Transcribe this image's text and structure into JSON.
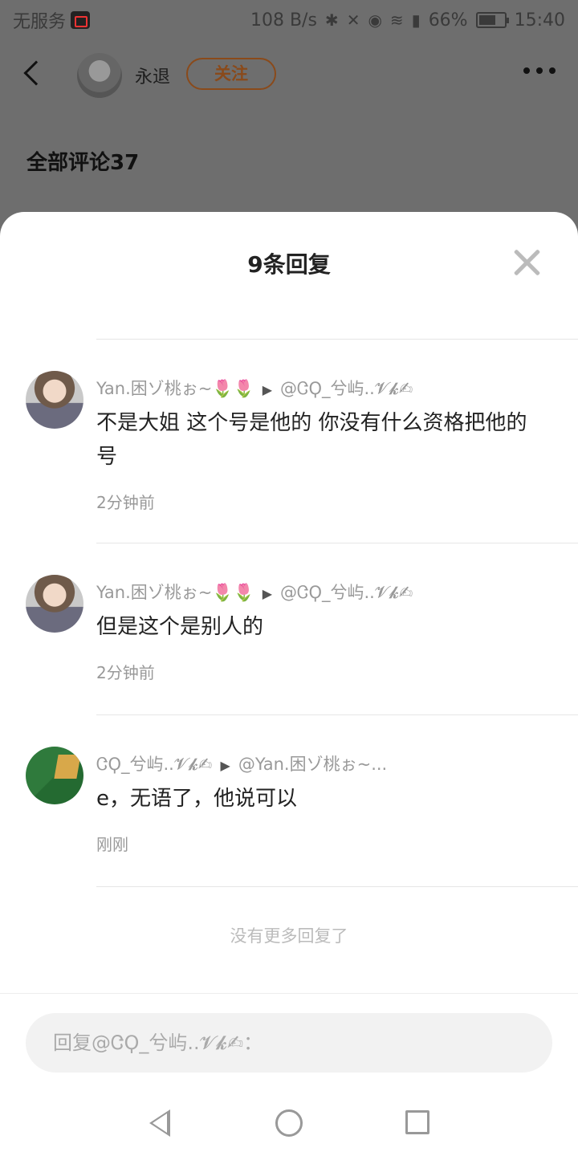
{
  "status_bar": {
    "carrier": "无服务",
    "net_speed": "108 B/s",
    "battery": "66%",
    "time": "15:40"
  },
  "background": {
    "author_name": "永退",
    "follow_label": "关注",
    "comments_header": "全部评论37"
  },
  "sheet": {
    "title": "9条回复",
    "replies": [
      {
        "from": "Yan.困ゾ桃ぉ~🌷🌷",
        "to": "@ᏣϘ_兮屿..𝓥𝓴✍",
        "text": "不是大姐 这个号是他的 你没有什么资格把他的号",
        "time": "2分钟前"
      },
      {
        "from": "Yan.困ゾ桃ぉ~🌷🌷",
        "to": "@ᏣϘ_兮屿..𝓥𝓴✍",
        "text": "但是这个是别人的",
        "time": "2分钟前"
      },
      {
        "from": "ᏣϘ_兮屿..𝓥𝓴✍",
        "to": "@Yan.困ゾ桃ぉ~...",
        "text": "e，无语了，他说可以",
        "time": "刚刚"
      }
    ],
    "no_more": "没有更多回复了",
    "reply_placeholder": "回复@ᏣϘ_兮屿..𝓥𝓴✍："
  }
}
